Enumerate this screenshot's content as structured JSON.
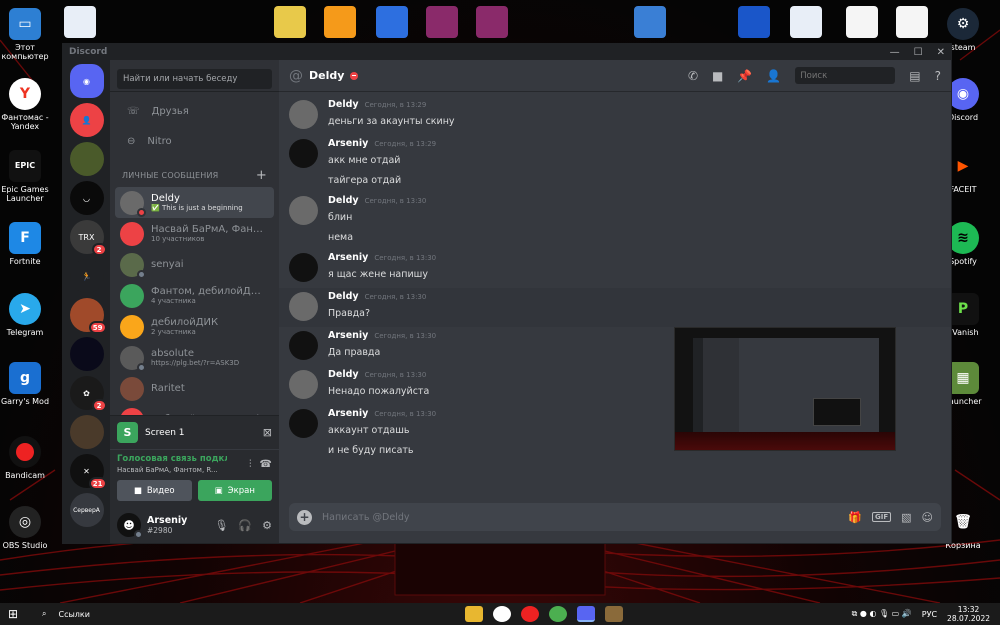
{
  "desktop": {
    "left_icons": [
      {
        "label": "Этот компьютер"
      },
      {
        "label": "Фантомас - Yandex"
      },
      {
        "label": "Epic Games Launcher"
      },
      {
        "label": "Fortnite"
      },
      {
        "label": "Telegram"
      },
      {
        "label": "Garry's Mod"
      },
      {
        "label": "Bandicam"
      },
      {
        "label": "OBS Studio"
      }
    ],
    "right_icons": [
      {
        "label": "steam"
      },
      {
        "label": "Discord"
      },
      {
        "label": "FACEIT"
      },
      {
        "label": "Spotify"
      },
      {
        "label": "PVanish"
      },
      {
        "label": "Launcher"
      },
      {
        "label": "Корзина"
      }
    ]
  },
  "window": {
    "app_title": "Discord",
    "controls": [
      "—",
      "☐",
      "✕"
    ]
  },
  "servers": [
    {
      "name": "home",
      "color": "#5865f2",
      "glyph": "◉",
      "badge": ""
    },
    {
      "name": "friends-requests",
      "color": "#ed4245",
      "glyph": "👤",
      "badge": ""
    },
    {
      "name": "server-2",
      "color": "#4a5a2a",
      "glyph": "",
      "badge": ""
    },
    {
      "name": "server-3",
      "color": "#0a0a0a",
      "glyph": "◡",
      "badge": ""
    },
    {
      "name": "server-4",
      "color": "#3a3a3a",
      "glyph": "TRX",
      "badge": "2"
    },
    {
      "name": "server-5",
      "color": "#202225",
      "glyph": "🏃",
      "badge": ""
    },
    {
      "name": "server-6",
      "color": "#a04a2a",
      "glyph": "",
      "badge": "59"
    },
    {
      "name": "server-7",
      "color": "#0a0a1a",
      "glyph": "",
      "badge": ""
    },
    {
      "name": "server-8",
      "color": "#1a1a1a",
      "glyph": "✿",
      "badge": "2"
    },
    {
      "name": "server-9",
      "color": "#4a3a2a",
      "glyph": "",
      "badge": ""
    },
    {
      "name": "server-10",
      "color": "#101010",
      "glyph": "✕",
      "badge": "21"
    },
    {
      "name": "server-11",
      "color": "#36393f",
      "glyph": "СерверА",
      "badge": ""
    }
  ],
  "sidebar": {
    "search_placeholder": "Найти или начать беседу",
    "friends": "Друзья",
    "nitro": "Nitro",
    "dm_header": "Личные сообщения",
    "dm_add": "+",
    "dms": [
      {
        "name": "Deldy",
        "sub": "✅ This is just a beginning",
        "color": "#6a6a6a",
        "status": "#ed4245",
        "active": true
      },
      {
        "name": "Насвай БаРмА, Фантом...",
        "sub": "10 участников",
        "color": "#ed4245",
        "status": "",
        "active": false
      },
      {
        "name": "senyai",
        "sub": "",
        "color": "#5a6a4a",
        "status": "#747f8d",
        "active": false
      },
      {
        "name": "Фантом, дебилойДИК...",
        "sub": "4 участника",
        "color": "#3ba55d",
        "status": "",
        "active": false
      },
      {
        "name": "дебилойДИК",
        "sub": "2 участника",
        "color": "#faa61a",
        "status": "",
        "active": false
      },
      {
        "name": "absolute",
        "sub": "https://plg.bet/?r=ASK3D",
        "color": "#5a5a5a",
        "status": "#747f8d",
        "active": false
      },
      {
        "name": "Raritet",
        "sub": "",
        "color": "#7a4a3a",
        "status": "",
        "active": false
      },
      {
        "name": "дебилойДИК, matvei",
        "sub": "",
        "color": "#ed4245",
        "status": "",
        "active": false
      }
    ]
  },
  "screen_share": {
    "thumb": "S",
    "label": "Screen 1"
  },
  "voice": {
    "status": "Голосовая связь подключена",
    "members": "Насвай БаРмА, Фантом, R...",
    "video_label": "Видео",
    "screen_label": "Экран"
  },
  "user": {
    "name": "Arseniy",
    "tag": "#2980"
  },
  "chat": {
    "channel": "Deldy",
    "search_placeholder": "Поиск",
    "composer_placeholder": "Написать @Deldy",
    "gif": "GIF",
    "messages": [
      {
        "author": "Deldy",
        "time": "Сегодня, в 13:29",
        "lines": [
          "деньги за акаунты скину"
        ],
        "avatar": "#6a6a6a",
        "hl": false
      },
      {
        "author": "Arseniy",
        "time": "Сегодня, в 13:29",
        "lines": [
          "акк мне отдай",
          "тайгера отдай"
        ],
        "avatar": "#111111",
        "hl": false
      },
      {
        "author": "Deldy",
        "time": "Сегодня, в 13:30",
        "lines": [
          "блин",
          "нема"
        ],
        "avatar": "#6a6a6a",
        "hl": false
      },
      {
        "author": "Arseniy",
        "time": "Сегодня, в 13:30",
        "lines": [
          "я щас жене напишу"
        ],
        "avatar": "#111111",
        "hl": false
      },
      {
        "author": "Deldy",
        "time": "Сегодня, в 13:30",
        "lines": [
          "Правда?"
        ],
        "avatar": "#6a6a6a",
        "hl": true
      },
      {
        "author": "Arseniy",
        "time": "Сегодня, в 13:30",
        "lines": [
          "Да правда"
        ],
        "avatar": "#111111",
        "hl": false
      },
      {
        "author": "Deldy",
        "time": "Сегодня, в 13:30",
        "lines": [
          "Ненадо пожалуйста"
        ],
        "avatar": "#6a6a6a",
        "hl": false
      },
      {
        "author": "Arseniy",
        "time": "Сегодня, в 13:30",
        "lines": [
          "аккаунт отдашь",
          "и не буду писать"
        ],
        "avatar": "#111111",
        "hl": false
      }
    ]
  },
  "taskbar": {
    "search_label": "Ссылки",
    "lang": "РУС",
    "time": "13:32",
    "date": "28.07.2022"
  }
}
